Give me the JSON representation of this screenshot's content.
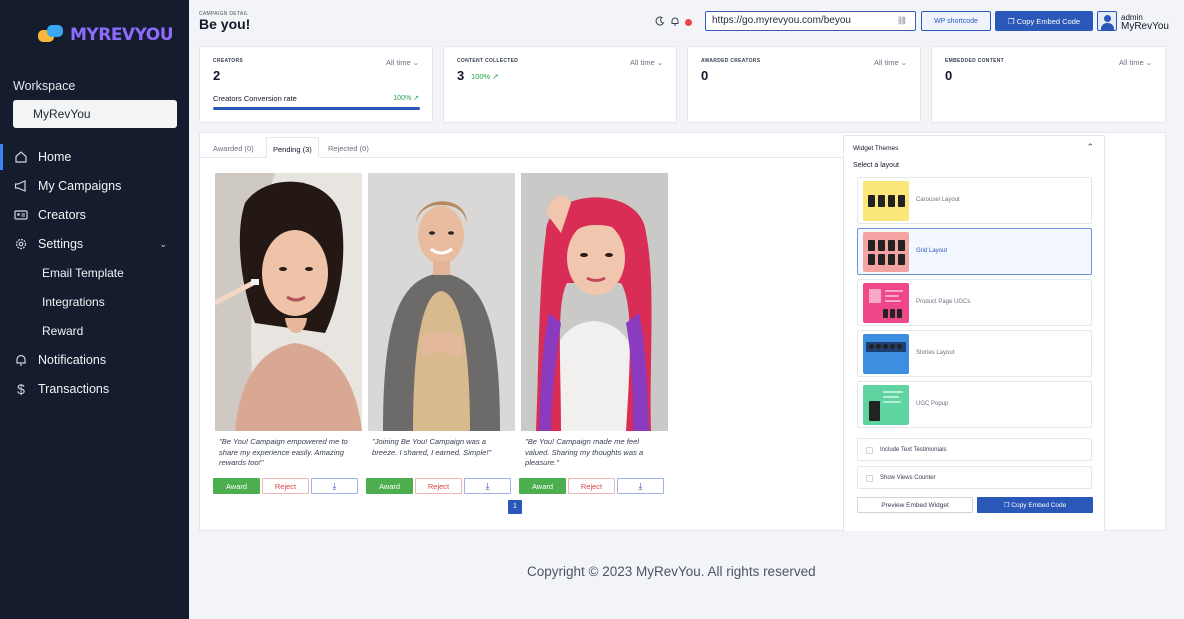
{
  "sidebar": {
    "logo": "MYREVYOU",
    "workspace_label": "Workspace",
    "workspace_value": "MyRevYou",
    "items": [
      {
        "label": "Home",
        "icon": "home-icon"
      },
      {
        "label": "My Campaigns",
        "icon": "megaphone-icon"
      },
      {
        "label": "Creators",
        "icon": "id-card-icon"
      },
      {
        "label": "Settings",
        "icon": "gear-icon"
      },
      {
        "label": "Notifications",
        "icon": "bell-icon"
      },
      {
        "label": "Transactions",
        "icon": "dollar-icon"
      }
    ],
    "sub_items": [
      "Email Template",
      "Integrations",
      "Reward"
    ]
  },
  "header": {
    "breadcrumb": "CAMPAIGN DETAIL",
    "title": "Be you!",
    "url": "https://go.myrevyou.com/beyou",
    "wp_label": "WP shortcode",
    "embed_label": "Copy Embed Code",
    "user_role": "admin",
    "user_org": "MyRevYou"
  },
  "stats": [
    {
      "label": "CREATORS",
      "period": "All time",
      "value": "2"
    },
    {
      "label": "CONTENT COLLECTED",
      "period": "All time",
      "value": "3",
      "pct": "100%"
    },
    {
      "label": "AWARDED CREATORS",
      "period": "All time",
      "value": "0"
    },
    {
      "label": "EMBEDDED CONTENT",
      "period": "All time",
      "value": "0"
    }
  ],
  "conversion": {
    "label": "Creators Conversion rate",
    "value": "100%",
    "fraction": 1.0
  },
  "tabs": [
    "Awarded (0)",
    "Pending (3)",
    "Rejected (0)"
  ],
  "ugc": [
    {
      "quote": "\"Be You! Campaign empowered me to share my experience easily. Amazing rewards too!\"",
      "award": "Award",
      "reject": "Reject"
    },
    {
      "quote": "\"Joining Be You! Campaign was a breeze. I shared, I earned. Simple!\"",
      "award": "Award",
      "reject": "Reject"
    },
    {
      "quote": "\"Be You! Campaign made me feel valued. Sharing my thoughts was a pleasure.\"",
      "award": "Award",
      "reject": "Reject"
    }
  ],
  "page": "1",
  "widget": {
    "title": "Widget Themes",
    "subtitle": "Select a layout",
    "layouts": [
      {
        "name": "Carousel Layout",
        "color": "#fbe67a"
      },
      {
        "name": "Grid Layout",
        "color": "#f4a3a3"
      },
      {
        "name": "Product Page UGCs",
        "color": "#f0478a"
      },
      {
        "name": "Stories Layout",
        "color": "#3b8ee0"
      },
      {
        "name": "UGC Popup",
        "color": "#5fd3a0"
      }
    ],
    "selected": "Grid Layout",
    "options": [
      "Include Text Testimonials",
      "Show Views Counter"
    ],
    "preview_label": "Preview Embed Widget",
    "copy_label": "Copy Embed Code"
  },
  "footer": "Copyright © 2023 MyRevYou. All rights reserved"
}
